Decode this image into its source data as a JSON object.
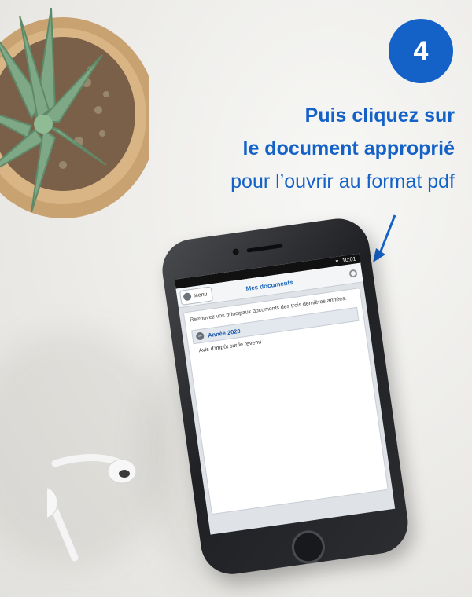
{
  "step": {
    "number": "4"
  },
  "headline": {
    "line1": "Puis cliquez sur",
    "line2": "le document approprié",
    "line3": "pour l’ouvrir au format pdf"
  },
  "phone": {
    "status_time": "10:01",
    "menu_label": "Menu",
    "page_title": "Mes documents",
    "intro_text": "Retrouvez vos principaux documents des trois dernières années.",
    "year_label": "Année 2020",
    "document_label": "Avis d’impôt sur le revenu"
  },
  "colors": {
    "accent": "#1462c8",
    "title_blue": "#1e66b5"
  },
  "icons": {
    "menu": "home-icon",
    "settings": "gear-icon",
    "collapse": "minus-circle-icon",
    "pointer": "arrow-down-left-icon"
  }
}
